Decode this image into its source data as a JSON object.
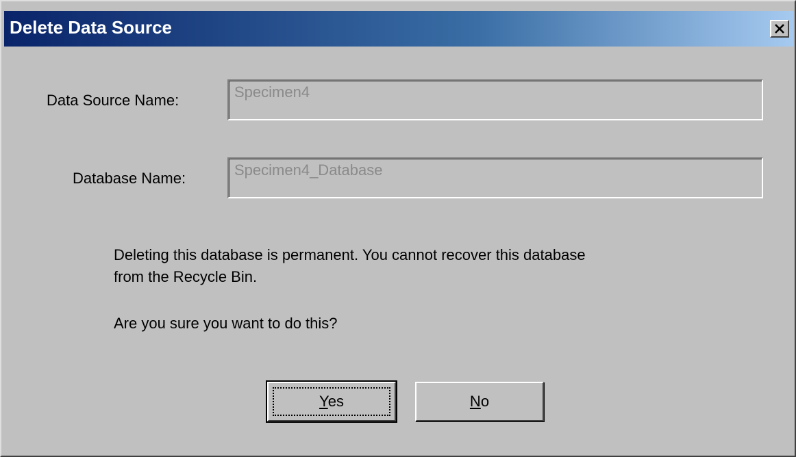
{
  "window": {
    "title": "Delete Data Source",
    "close_symbol": "✕"
  },
  "fields": {
    "data_source_label": "Data Source Name:",
    "data_source_value": "Specimen4",
    "database_label": "Database Name:",
    "database_value": "Specimen4_Database"
  },
  "message": {
    "line1": "Deleting this database is permanent.  You cannot recover this database",
    "line2": "from the Recycle Bin.",
    "question": "Are you sure you want to do this?"
  },
  "buttons": {
    "yes_mnemonic": "Y",
    "yes_rest": "es",
    "no_mnemonic": "N",
    "no_rest": "o"
  },
  "colors": {
    "title_bar_start": "#0a246a",
    "title_bar_end": "#a6caf0",
    "dialog_face": "#c0c0c0",
    "disabled_text": "#8a8a8a"
  }
}
